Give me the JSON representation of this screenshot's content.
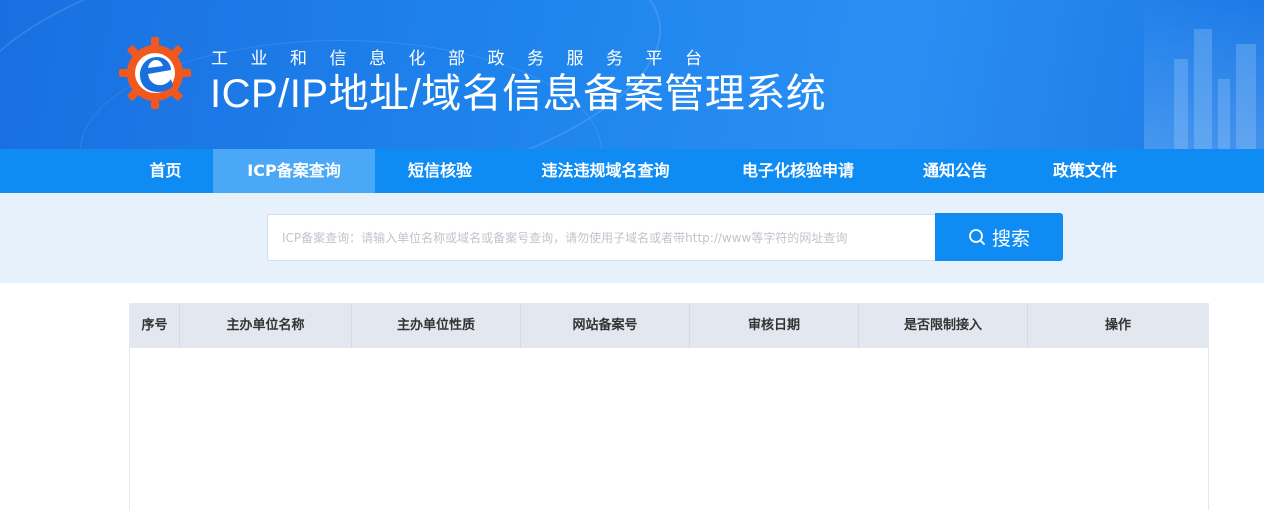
{
  "header": {
    "subtitle": "工业和信息化部政务服务平台",
    "title": "ICP/IP地址/域名信息备案管理系统"
  },
  "nav": {
    "items": [
      {
        "label": "首页",
        "active": false
      },
      {
        "label": "ICP备案查询",
        "active": true
      },
      {
        "label": "短信核验",
        "active": false
      },
      {
        "label": "违法违规域名查询",
        "active": false
      },
      {
        "label": "电子化核验申请",
        "active": false
      },
      {
        "label": "通知公告",
        "active": false
      },
      {
        "label": "政策文件",
        "active": false
      }
    ]
  },
  "search": {
    "placeholder": "ICP备案查询：请输入单位名称或域名或备案号查询，请勿使用子域名或者带http://www等字符的网址查询",
    "value": "",
    "button_label": "搜索",
    "button_icon": "search-icon"
  },
  "table": {
    "columns": [
      "序号",
      "主办单位名称",
      "主办单位性质",
      "网站备案号",
      "审核日期",
      "是否限制接入",
      "操作"
    ],
    "rows": []
  },
  "colors": {
    "nav_bg": "#0f8cf4",
    "nav_active": "#4aa8f6",
    "search_band": "#e6f1fc",
    "table_header": "#e2e7f0",
    "logo_orange": "#f0581e",
    "logo_blue": "#1a6fe0"
  }
}
